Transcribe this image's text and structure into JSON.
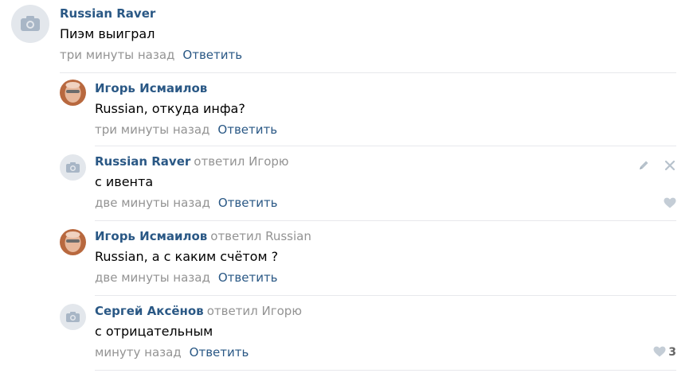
{
  "comments": [
    {
      "author": "Russian Raver",
      "replied_to": "",
      "text": "Пиэм выиграл",
      "time": "три минуты назад",
      "reply_label": "Ответить",
      "avatar": "camera-icon",
      "likes": ""
    },
    {
      "author": "Игорь Исмаилов",
      "replied_to": "",
      "text": "Russian, откуда инфа?",
      "time": "три минуты назад",
      "reply_label": "Ответить",
      "avatar": "user-photo",
      "likes": ""
    },
    {
      "author": "Russian Raver",
      "replied_to": "ответил Игорю",
      "text": "с ивента",
      "time": "две минуты назад",
      "reply_label": "Ответить",
      "avatar": "camera-icon",
      "likes": "",
      "tools": [
        "edit-pencil-icon",
        "delete-x-icon"
      ]
    },
    {
      "author": "Игорь Исмаилов",
      "replied_to": "ответил Russian",
      "text": "Russian, а с каким счётом ?",
      "time": "две минуты назад",
      "reply_label": "Ответить",
      "avatar": "user-photo",
      "likes": ""
    },
    {
      "author": "Сергей Аксёнов",
      "replied_to": "ответил Игорю",
      "text": "с отрицательным",
      "time": "минуту назад",
      "reply_label": "Ответить",
      "avatar": "camera-icon",
      "likes": "3"
    }
  ],
  "colors": {
    "link": "#2a5885",
    "muted": "#939393",
    "divider": "#e7e8ec",
    "avatar_bg": "#e3e7ec"
  }
}
